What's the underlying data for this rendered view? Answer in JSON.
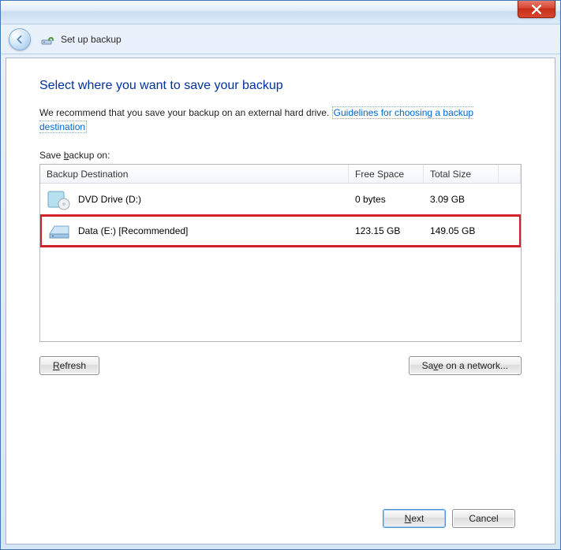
{
  "window": {
    "nav_title": "Set up backup"
  },
  "page": {
    "heading": "Select where you want to save your backup",
    "intro_text": "We recommend that you save your backup on an external hard drive. ",
    "intro_link": "Guidelines for choosing a backup destination",
    "list_label_pre": "Save ",
    "list_label_accel": "b",
    "list_label_post": "ackup on:"
  },
  "columns": {
    "destination": "Backup Destination",
    "free": "Free Space",
    "size": "Total Size"
  },
  "rows": [
    {
      "icon": "dvd",
      "name": "DVD Drive (D:)",
      "free": "0 bytes",
      "size": "3.09 GB",
      "highlight": false
    },
    {
      "icon": "hdd",
      "name": "Data (E:) [Recommended]",
      "free": "123.15 GB",
      "size": "149.05 GB",
      "highlight": true
    }
  ],
  "buttons": {
    "refresh_accel": "R",
    "refresh_rest": "efresh",
    "network_pre": "Sa",
    "network_accel": "v",
    "network_post": "e on a network...",
    "next_accel": "N",
    "next_rest": "ext",
    "cancel": "Cancel"
  }
}
